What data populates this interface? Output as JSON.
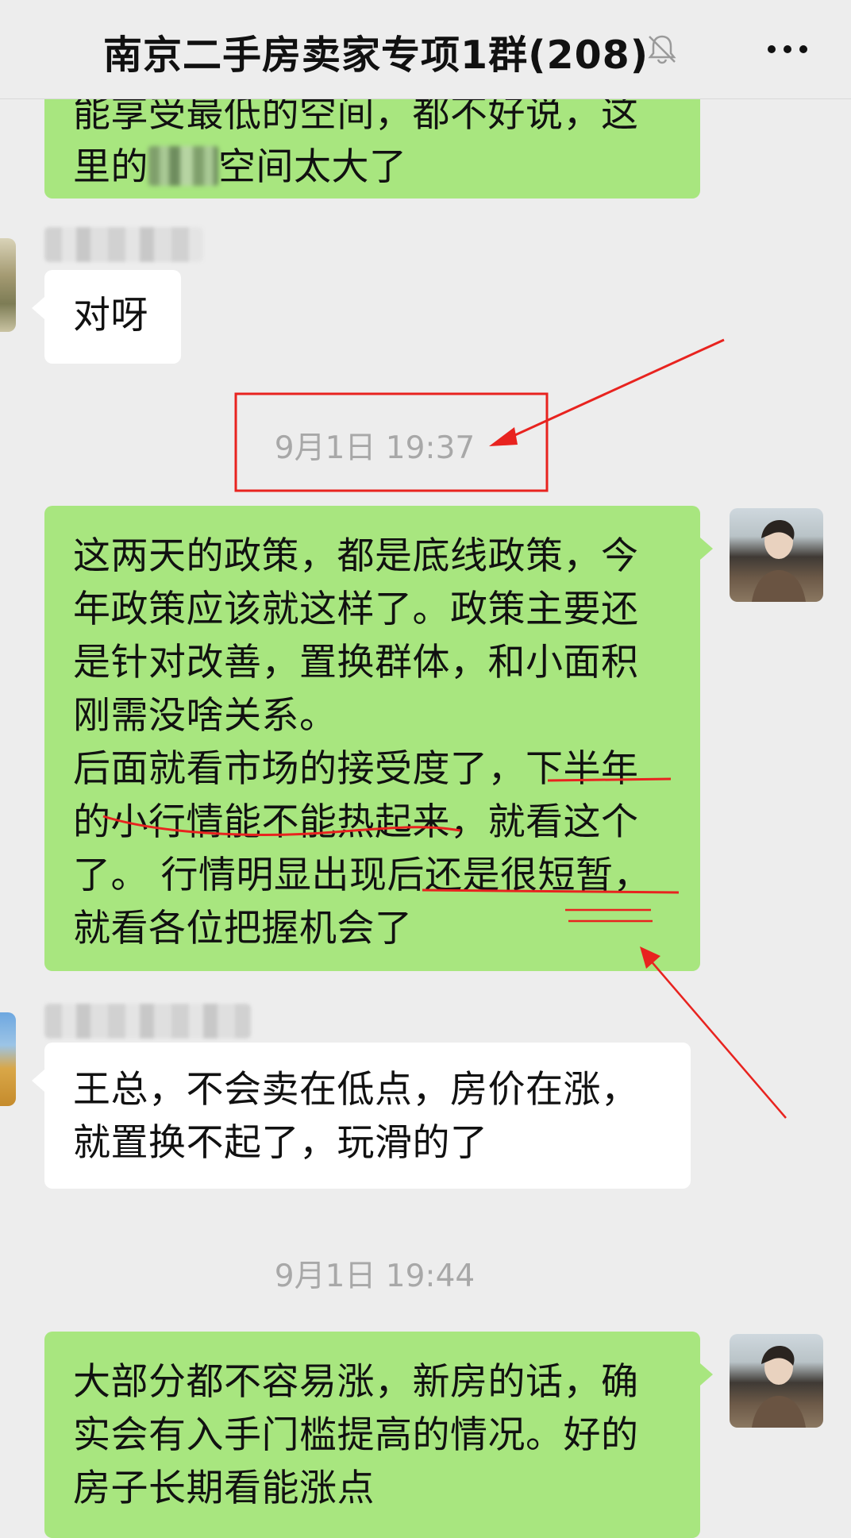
{
  "header": {
    "title": "南京二手房卖家专项1群(208)",
    "mute_icon": "bell-muted-icon",
    "more_icon": "more-dots-icon"
  },
  "messages": [
    {
      "text": "能享受最低的空间，都不好说，这\n里的",
      "text_after": "空间太大了"
    },
    {
      "text": "对呀"
    },
    {
      "text": "这两天的政策，都是底线政策，今\n年政策应该就这样了。政策主要还\n是针对改善，置换群体，和小面积\n刚需没啥关系。\n后面就看市场的接受度了，下半年\n的小行情能不能热起来，就看这个\n了。 行情明显出现后还是很短暂，\n就看各位把握机会了"
    },
    {
      "text": "王总，不会卖在低点，房价在涨，\n就置换不起了，玩滑的了"
    },
    {
      "text": "大部分都不容易涨，新房的话，确\n实会有入手门槛提高的情况。好的\n房子长期看能涨点"
    }
  ],
  "timestamps": [
    "9月1日 19:37",
    "9月1日 19:44"
  ],
  "colors": {
    "background": "#ededed",
    "self_bubble": "#a8e67f",
    "other_bubble": "#ffffff",
    "annotation_red": "#e8231f"
  }
}
